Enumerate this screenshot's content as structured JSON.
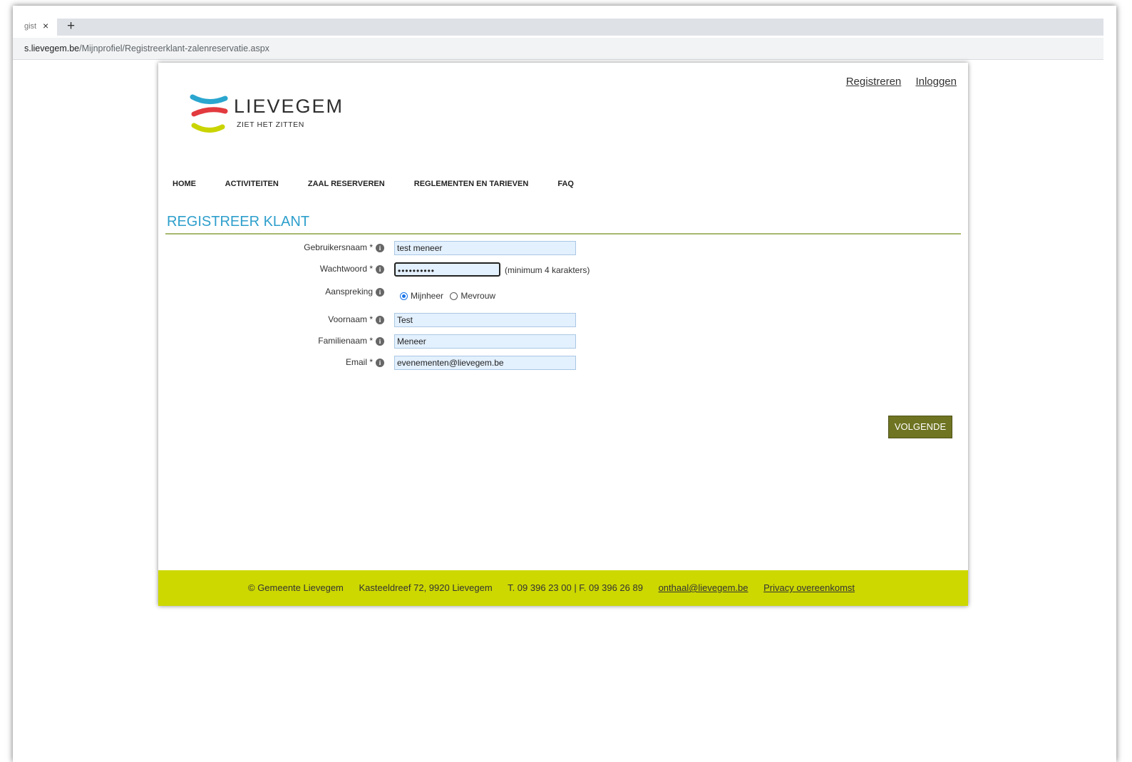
{
  "browser": {
    "tab_title": "gist",
    "tab_close": "×",
    "new_tab": "+",
    "url_host": "s.lievegem.be",
    "url_path": "/Mijnprofiel/Registreerklant-zalenreservatie.aspx"
  },
  "header": {
    "register_link": "Registreren",
    "login_link": "Inloggen",
    "logo_word": "LIEVEGEM",
    "logo_tagline": "ZIET HET ZITTEN"
  },
  "nav": {
    "items": [
      "HOME",
      "ACTIVITEITEN",
      "ZAAL RESERVEREN",
      "REGLEMENTEN EN TARIEVEN",
      "FAQ"
    ]
  },
  "form": {
    "title": "REGISTREER KLANT",
    "username_label": "Gebruikersnaam *",
    "username_value": "test meneer",
    "password_label": "Wachtwoord *",
    "password_value": "••••••••••",
    "password_hint": "(minimum 4 karakters)",
    "salutation_label": "Aanspreking",
    "salutation_options": [
      "Mijnheer",
      "Mevrouw"
    ],
    "salutation_selected": "Mijnheer",
    "firstname_label": "Voornaam *",
    "firstname_value": "Test",
    "lastname_label": "Familienaam *",
    "lastname_value": "Meneer",
    "email_label": "Email *",
    "email_value": "evenementen@lievegem.be",
    "info_icon": "i",
    "next_button": "VOLGENDE"
  },
  "footer": {
    "copyright": "© Gemeente Lievegem",
    "address": "Kasteeldreef 72, 9920 Lievegem",
    "phone": "T. 09 396 23 00 | F. 09 396 26 89",
    "email_link": "onthaal@lievegem.be",
    "privacy_link": "Privacy overeenkomst"
  },
  "colors": {
    "title_blue": "#2e9fcc",
    "footer_lime": "#cdd800",
    "button_olive": "#6f7422",
    "logo_blue": "#2aa6cf",
    "logo_red": "#e23a3f",
    "logo_lime": "#c9d400"
  }
}
